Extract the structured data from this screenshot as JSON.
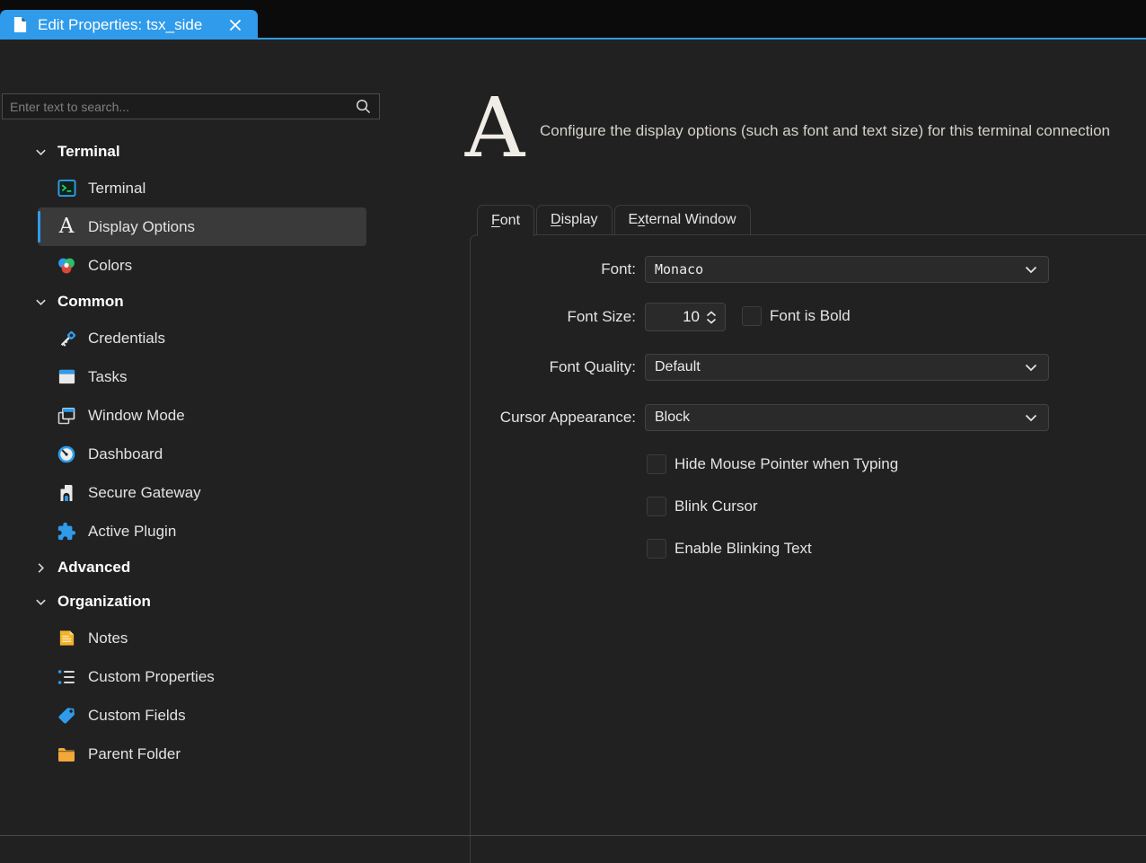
{
  "window": {
    "tab_title": "Edit Properties: tsx_side",
    "accent_color": "#2f9bea"
  },
  "icons": {
    "tab": "document-page",
    "close": "x-cross",
    "search": "magnifier",
    "group_expanded": "chevron-down",
    "group_collapsed": "chevron-right",
    "dropdown": "chevron-down"
  },
  "sidebar": {
    "search_placeholder": "Enter text to search...",
    "tree": [
      {
        "type": "group",
        "label": "Terminal",
        "expanded": true
      },
      {
        "type": "item",
        "label": "Terminal",
        "icon": "terminal-icon"
      },
      {
        "type": "item",
        "label": "Display Options",
        "icon": "display-options-icon",
        "selected": true
      },
      {
        "type": "item",
        "label": "Colors",
        "icon": "colors-icon"
      },
      {
        "type": "group",
        "label": "Common",
        "expanded": true
      },
      {
        "type": "item",
        "label": "Credentials",
        "icon": "credentials-icon"
      },
      {
        "type": "item",
        "label": "Tasks",
        "icon": "tasks-icon"
      },
      {
        "type": "item",
        "label": "Window Mode",
        "icon": "window-mode-icon"
      },
      {
        "type": "item",
        "label": "Dashboard",
        "icon": "dashboard-icon"
      },
      {
        "type": "item",
        "label": "Secure Gateway",
        "icon": "secure-gateway-icon"
      },
      {
        "type": "item",
        "label": "Active Plugin",
        "icon": "active-plugin-icon"
      },
      {
        "type": "group",
        "label": "Advanced",
        "expanded": false
      },
      {
        "type": "group",
        "label": "Organization",
        "expanded": true
      },
      {
        "type": "item",
        "label": "Notes",
        "icon": "notes-icon"
      },
      {
        "type": "item",
        "label": "Custom Properties",
        "icon": "custom-properties-icon"
      },
      {
        "type": "item",
        "label": "Custom Fields",
        "icon": "custom-fields-icon"
      },
      {
        "type": "item",
        "label": "Parent Folder",
        "icon": "parent-folder-icon"
      }
    ]
  },
  "header": {
    "icon": "serif-letter-A",
    "description": "Configure the display options (such as font and text size) for this terminal connection"
  },
  "tabs": [
    {
      "pre": "",
      "key": "F",
      "post": "ont",
      "active": true
    },
    {
      "pre": "",
      "key": "D",
      "post": "isplay",
      "active": false
    },
    {
      "pre": "E",
      "key": "x",
      "post": "ternal Window",
      "active": false
    }
  ],
  "form": {
    "font": {
      "label": "Font:",
      "value": "Monaco"
    },
    "font_size": {
      "label": "Font Size:",
      "value": "10"
    },
    "font_bold": {
      "label": "Font is Bold",
      "checked": false
    },
    "font_quality": {
      "label": "Font Quality:",
      "value": "Default"
    },
    "cursor_appearance": {
      "label": "Cursor Appearance:",
      "value": "Block"
    },
    "checkboxes": [
      {
        "label": "Hide Mouse Pointer when Typing",
        "checked": false
      },
      {
        "label": "Blink Cursor",
        "checked": false
      },
      {
        "label": "Enable Blinking Text",
        "checked": false
      }
    ]
  }
}
